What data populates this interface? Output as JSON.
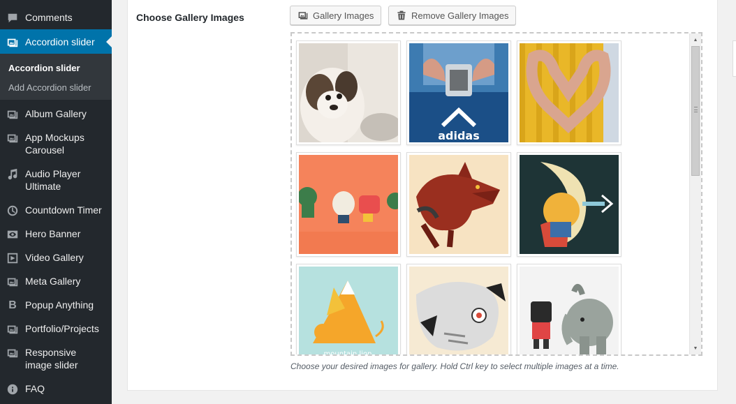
{
  "sidebar": {
    "items": [
      {
        "label": "Comments",
        "icon": "comment-icon"
      },
      {
        "label": "Accordion slider",
        "icon": "gallery-icon",
        "active": true
      },
      {
        "label": "Album Gallery",
        "icon": "gallery-icon"
      },
      {
        "label": "App Mockups Carousel",
        "icon": "gallery-icon"
      },
      {
        "label": "Audio Player Ultimate",
        "icon": "music-icon"
      },
      {
        "label": "Countdown Timer",
        "icon": "clock-icon"
      },
      {
        "label": "Hero Banner",
        "icon": "eye-icon"
      },
      {
        "label": "Video Gallery",
        "icon": "video-icon"
      },
      {
        "label": "Meta Gallery",
        "icon": "gallery-icon"
      },
      {
        "label": "Popup Anything",
        "icon": "bold-b-icon"
      },
      {
        "label": "Portfolio/Projects",
        "icon": "gallery-icon"
      },
      {
        "label": "Responsive image slider",
        "icon": "gallery-icon"
      },
      {
        "label": "FAQ",
        "icon": "info-icon"
      }
    ],
    "submenu": {
      "current": "Accordion slider",
      "add": "Add Accordion slider"
    }
  },
  "field": {
    "label": "Choose Gallery Images",
    "gallery_button": "Gallery Images",
    "remove_button": "Remove Gallery Images",
    "help_text": "Choose your desired images for gallery. Hold Ctrl key to select multiple images at a time."
  },
  "gallery": {
    "images": [
      "puppy",
      "hoodie-hands",
      "heart-hands",
      "veggie-characters",
      "wolf-illustration",
      "moon-hero",
      "mountain-lion",
      "elephant-skeleton",
      "robot-elephant"
    ],
    "caption_mountain": "mountain lion"
  },
  "colors": {
    "sidebar_bg": "#23282d",
    "active": "#0073aa",
    "submenu_bg": "#32373c"
  }
}
